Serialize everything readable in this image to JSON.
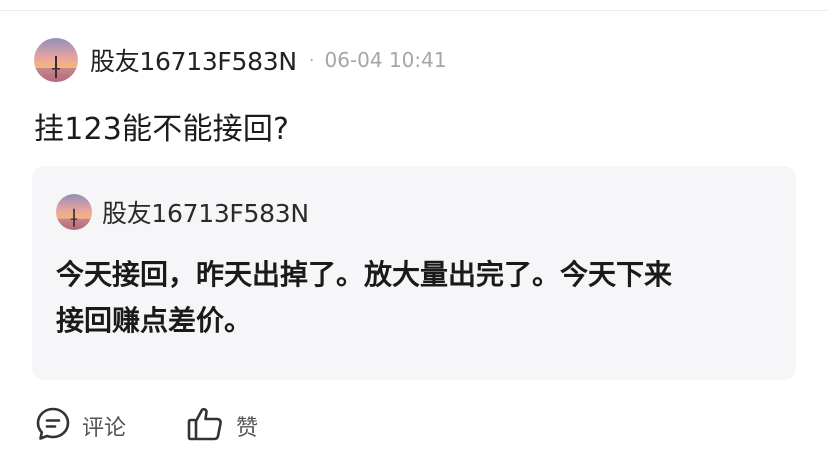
{
  "post": {
    "author": "股友16713F583N",
    "separator": "·",
    "timestamp": "06-04 10:41",
    "content": "挂123能不能接回?"
  },
  "quote": {
    "author": "股友16713F583N",
    "line1": "今天接回，昨天出掉了。放大量出完了。今天下来",
    "line2": "接回赚点差价。"
  },
  "actions": {
    "comment_icon": "comment-icon",
    "comment_label": "评论",
    "like_icon": "thumbs-up-icon",
    "like_label": "赞"
  },
  "colors": {
    "quote_bg": "#f6f6f8",
    "muted_text": "#a6a6a6"
  }
}
